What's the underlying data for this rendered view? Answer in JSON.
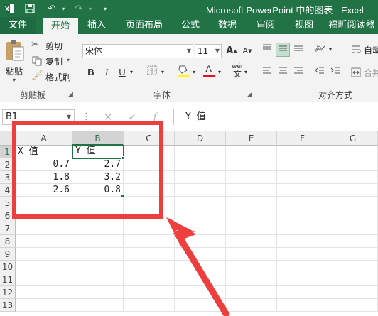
{
  "window": {
    "title": "Microsoft PowerPoint 中的图表 - Excel"
  },
  "ribbon_tabs": [
    "文件",
    "开始",
    "插入",
    "页面布局",
    "公式",
    "数据",
    "审阅",
    "视图",
    "福昕阅读器"
  ],
  "active_tab": "开始",
  "clipboard": {
    "paste_label": "粘贴",
    "cut_label": "剪切",
    "copy_label": "复制",
    "format_painter_label": "格式刷",
    "group_label": "剪贴板"
  },
  "font": {
    "font_name": "宋体",
    "font_size": "11",
    "bold": "B",
    "italic": "I",
    "underline": "U",
    "group_label": "字体",
    "font_color_letter": "A",
    "pinyin_label": "wén",
    "highlight_color": "#ffff00",
    "font_color": "#e81123"
  },
  "alignment": {
    "wrap_label": "自动",
    "merge_label": "合并",
    "group_label": "对齐方式"
  },
  "formula_bar": {
    "name_box": "B1",
    "formula_content": "Y 值"
  },
  "sheet": {
    "columns": [
      "A",
      "B",
      "C",
      "D",
      "E",
      "F",
      "G"
    ],
    "selected_column": "B",
    "rows": [
      "1",
      "2",
      "3",
      "4",
      "5",
      "6",
      "7",
      "8",
      "9",
      "10",
      "11",
      "12",
      "13"
    ],
    "selected_row": "1",
    "header_row": [
      "X 值",
      "Y 值"
    ],
    "data": [
      [
        "0.7",
        "2.7"
      ],
      [
        "1.8",
        "3.2"
      ],
      [
        "2.6",
        "0.8"
      ]
    ]
  },
  "colors": {
    "excel_green": "#217346",
    "annotation_red": "#ee3f3f"
  }
}
